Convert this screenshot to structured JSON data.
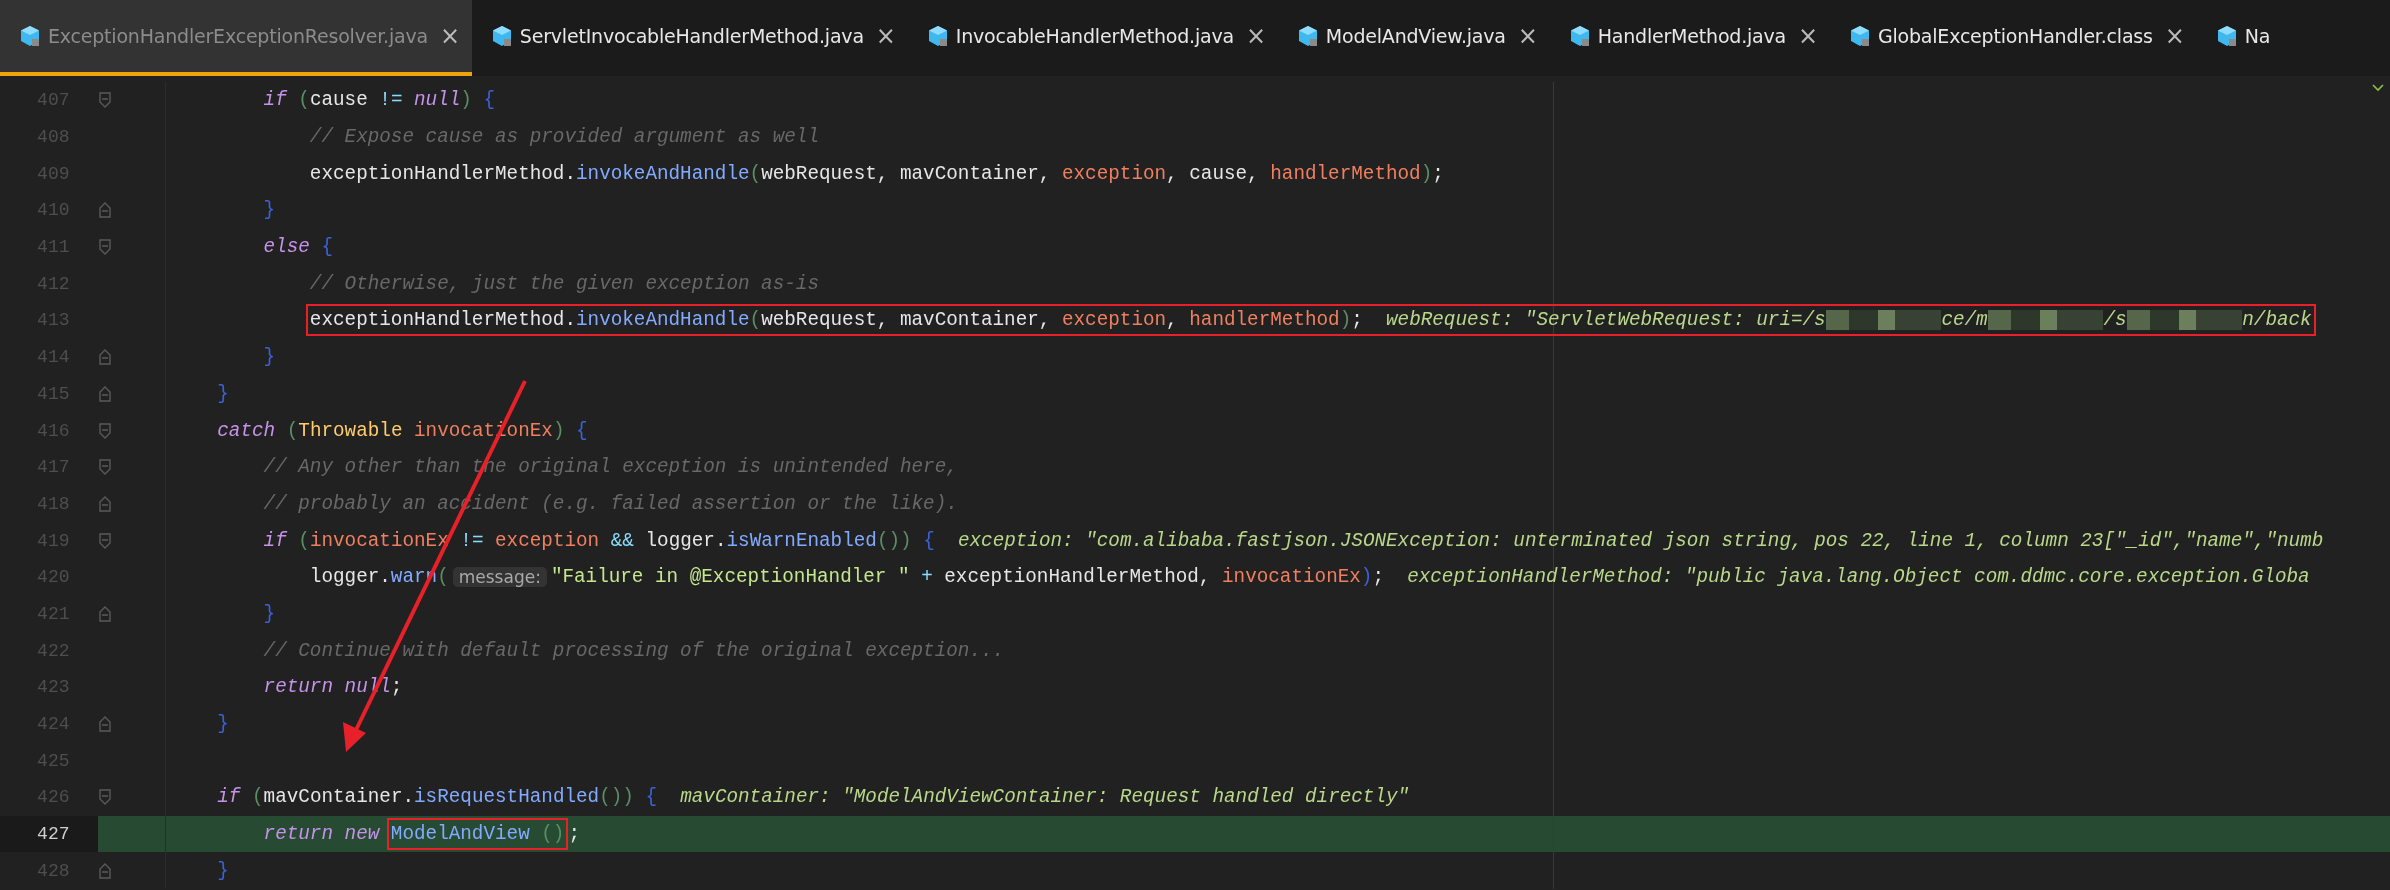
{
  "tabs": [
    {
      "label": "ExceptionHandlerExceptionResolver.java",
      "selected": true,
      "close": "×"
    },
    {
      "label": "ServletInvocableHandlerMethod.java",
      "selected": false,
      "close": "×"
    },
    {
      "label": "InvocableHandlerMethod.java",
      "selected": false,
      "close": "×"
    },
    {
      "label": "ModelAndView.java",
      "selected": false,
      "close": "×"
    },
    {
      "label": "HandlerMethod.java",
      "selected": false,
      "close": "×"
    },
    {
      "label": "GlobalExceptionHandler.class",
      "selected": false,
      "close": "×"
    },
    {
      "label": "Na",
      "selected": false
    }
  ],
  "editor": {
    "lines": [
      {
        "number": "407",
        "fold_start": true,
        "fold_end": false,
        "current": false,
        "tokens": [
          {
            "kind": "keyword",
            "text": "        if"
          },
          {
            "kind": "paren",
            "text": " ("
          },
          {
            "kind": "plain",
            "text": "cause "
          },
          {
            "kind": "op",
            "text": "!= "
          },
          {
            "kind": "keyword",
            "text": "null"
          },
          {
            "kind": "paren",
            "text": ")"
          },
          {
            "kind": "brace",
            "text": " {"
          }
        ]
      },
      {
        "number": "408",
        "fold_start": false,
        "fold_end": false,
        "current": false,
        "tokens": [
          {
            "kind": "comment",
            "text": "            // Expose cause as provided argument as well"
          }
        ]
      },
      {
        "number": "409",
        "fold_start": false,
        "fold_end": false,
        "current": false,
        "tokens": [
          {
            "kind": "plain",
            "text": "            exceptionHandlerMethod."
          },
          {
            "kind": "method",
            "text": "invokeAndHandle"
          },
          {
            "kind": "paren",
            "text": "("
          },
          {
            "kind": "plain",
            "text": "webRequest, mavContainer, "
          },
          {
            "kind": "param",
            "text": "exception"
          },
          {
            "kind": "plain",
            "text": ", cause, "
          },
          {
            "kind": "param",
            "text": "handlerMethod"
          },
          {
            "kind": "paren",
            "text": ")"
          },
          {
            "kind": "plain",
            "text": ";"
          }
        ]
      },
      {
        "number": "410",
        "fold_start": false,
        "fold_end": true,
        "current": false,
        "tokens": [
          {
            "kind": "brace",
            "text": "        }"
          }
        ]
      },
      {
        "number": "411",
        "fold_start": true,
        "fold_end": false,
        "current": false,
        "tokens": [
          {
            "kind": "keyword",
            "text": "        else"
          },
          {
            "kind": "brace",
            "text": " {"
          }
        ]
      },
      {
        "number": "412",
        "fold_start": false,
        "fold_end": false,
        "current": false,
        "tokens": [
          {
            "kind": "comment",
            "text": "            // Otherwise, just the given exception as-is"
          }
        ]
      },
      {
        "number": "413",
        "fold_start": false,
        "fold_end": false,
        "current": false,
        "tokens": [
          {
            "kind": "box",
            "tokens": [
              {
                "kind": "plain",
                "text": "            exceptionHandlerMethod."
              },
              {
                "kind": "method",
                "text": "invokeAndHandle"
              },
              {
                "kind": "paren",
                "text": "("
              },
              {
                "kind": "plain",
                "text": "webRequest, mavContainer, "
              },
              {
                "kind": "param",
                "text": "exception"
              },
              {
                "kind": "plain",
                "text": ", "
              },
              {
                "kind": "param",
                "text": "handlerMethod"
              },
              {
                "kind": "paren",
                "text": ")"
              },
              {
                "kind": "plain",
                "text": ";"
              },
              {
                "kind": "hint",
                "text": "webRequest: \"ServletWebRequest: uri=/s"
              },
              {
                "kind": "redacted"
              },
              {
                "kind": "hint",
                "text": "ce/m"
              },
              {
                "kind": "redacted"
              },
              {
                "kind": "hint",
                "text": "/s"
              },
              {
                "kind": "redacted"
              },
              {
                "kind": "hint",
                "text": "n/back"
              }
            ]
          }
        ]
      },
      {
        "number": "414",
        "fold_start": false,
        "fold_end": true,
        "current": false,
        "tokens": [
          {
            "kind": "brace",
            "text": "        }"
          }
        ]
      },
      {
        "number": "415",
        "fold_start": false,
        "fold_end": true,
        "current": false,
        "tokens": [
          {
            "kind": "brace",
            "text": "    }"
          }
        ]
      },
      {
        "number": "416",
        "fold_start": true,
        "fold_end": false,
        "current": false,
        "tokens": [
          {
            "kind": "keyword",
            "text": "    catch"
          },
          {
            "kind": "paren",
            "text": " ("
          },
          {
            "kind": "type",
            "text": "Throwable "
          },
          {
            "kind": "param",
            "text": "invocationEx"
          },
          {
            "kind": "paren",
            "text": ")"
          },
          {
            "kind": "brace",
            "text": " {"
          }
        ]
      },
      {
        "number": "417",
        "fold_start": true,
        "fold_end": false,
        "current": false,
        "tokens": [
          {
            "kind": "comment",
            "text": "        // Any other than the original exception is unintended here,"
          }
        ]
      },
      {
        "number": "418",
        "fold_start": false,
        "fold_end": true,
        "current": false,
        "tokens": [
          {
            "kind": "comment",
            "text": "        // probably an accident (e.g. failed assertion or the like)."
          }
        ]
      },
      {
        "number": "419",
        "fold_start": true,
        "fold_end": false,
        "current": false,
        "tokens": [
          {
            "kind": "keyword",
            "text": "        if"
          },
          {
            "kind": "paren",
            "text": " ("
          },
          {
            "kind": "param",
            "text": "invocationEx"
          },
          {
            "kind": "op",
            "text": " != "
          },
          {
            "kind": "param",
            "text": "exception"
          },
          {
            "kind": "op",
            "text": " && "
          },
          {
            "kind": "plain",
            "text": "logger."
          },
          {
            "kind": "method",
            "text": "isWarnEnabled"
          },
          {
            "kind": "paren",
            "text": "())"
          },
          {
            "kind": "brace",
            "text": " {"
          },
          {
            "kind": "hint",
            "text": "exception: \"com.alibaba.fastjson.JSONException: unterminated json string, pos 22, line 1, column 23[\"_id\",\"name\",\"numb"
          }
        ]
      },
      {
        "number": "420",
        "fold_start": false,
        "fold_end": false,
        "current": false,
        "tokens": [
          {
            "kind": "plain",
            "text": "            logger."
          },
          {
            "kind": "method",
            "text": "warn"
          },
          {
            "kind": "paren",
            "text": "("
          },
          {
            "kind": "inlay",
            "text": "message:"
          },
          {
            "kind": "string",
            "text": "\"Failure in @ExceptionHandler \""
          },
          {
            "kind": "op",
            "text": " + "
          },
          {
            "kind": "plain",
            "text": "exceptionHandlerMethod, "
          },
          {
            "kind": "param",
            "text": "invocationEx"
          },
          {
            "kind": "brace",
            "text": ")"
          },
          {
            "kind": "plain",
            "text": ";"
          },
          {
            "kind": "hint",
            "text": "exceptionHandlerMethod: \"public java.lang.Object com.ddmc.core.exception.Globa"
          }
        ]
      },
      {
        "number": "421",
        "fold_start": false,
        "fold_end": true,
        "current": false,
        "tokens": [
          {
            "kind": "brace",
            "text": "        }"
          }
        ]
      },
      {
        "number": "422",
        "fold_start": false,
        "fold_end": false,
        "current": false,
        "tokens": [
          {
            "kind": "comment",
            "text": "        // Continue with default processing of the original exception..."
          }
        ]
      },
      {
        "number": "423",
        "fold_start": false,
        "fold_end": false,
        "current": false,
        "tokens": [
          {
            "kind": "keyword",
            "text": "        return null"
          },
          {
            "kind": "plain",
            "text": ";"
          }
        ]
      },
      {
        "number": "424",
        "fold_start": false,
        "fold_end": true,
        "current": false,
        "tokens": [
          {
            "kind": "brace",
            "text": "    }"
          }
        ]
      },
      {
        "number": "425",
        "fold_start": false,
        "fold_end": false,
        "current": false
      },
      {
        "number": "426",
        "fold_start": true,
        "fold_end": false,
        "current": false,
        "tokens": [
          {
            "kind": "keyword",
            "text": "    if"
          },
          {
            "kind": "paren",
            "text": " ("
          },
          {
            "kind": "plain",
            "text": "mavContainer."
          },
          {
            "kind": "method",
            "text": "isRequestHandled"
          },
          {
            "kind": "paren",
            "text": "())"
          },
          {
            "kind": "brace",
            "text": " {"
          },
          {
            "kind": "hint",
            "text": "mavContainer: \"ModelAndViewContainer: Request handled directly\""
          }
        ]
      },
      {
        "number": "427",
        "fold_start": false,
        "fold_end": false,
        "current": true,
        "tokens": [
          {
            "kind": "keyword",
            "text": "        return new "
          },
          {
            "kind": "box",
            "tokens": [
              {
                "kind": "method",
                "text": "ModelAndView"
              },
              {
                "kind": "paren",
                "text": " ()"
              }
            ]
          },
          {
            "kind": "plain",
            "text": ";"
          }
        ]
      },
      {
        "number": "428",
        "fold_start": false,
        "fold_end": true,
        "current": false,
        "tokens": [
          {
            "kind": "brace",
            "text": "    }"
          }
        ]
      }
    ]
  }
}
